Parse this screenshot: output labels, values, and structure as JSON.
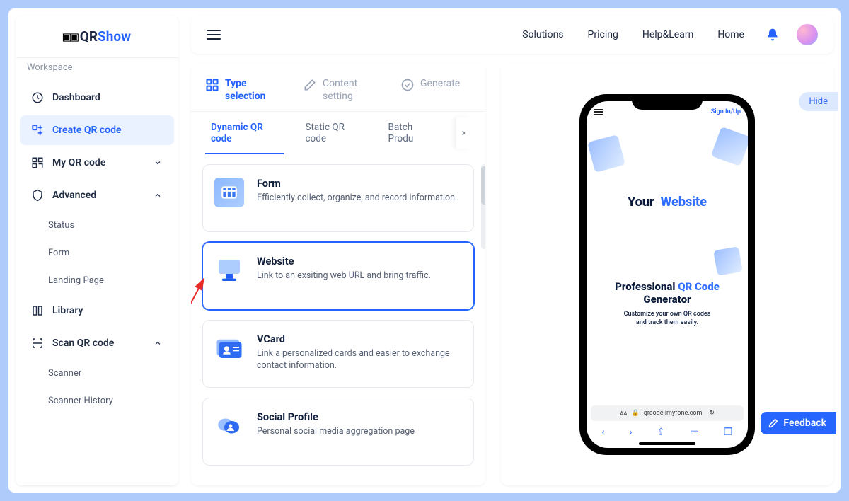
{
  "logo": {
    "prefix": "QR",
    "suffix": "Show"
  },
  "workspace_label": "Workspace",
  "sidebar": {
    "dashboard": "Dashboard",
    "create": "Create QR code",
    "myqr": "My QR code",
    "advanced": "Advanced",
    "advanced_children": {
      "status": "Status",
      "form": "Form",
      "landing": "Landing Page"
    },
    "library": "Library",
    "scan": "Scan QR code",
    "scan_children": {
      "scanner": "Scanner",
      "history": "Scanner History"
    }
  },
  "header": {
    "links": {
      "solutions": "Solutions",
      "pricing": "Pricing",
      "help": "Help&Learn",
      "home": "Home"
    }
  },
  "steps": {
    "type": "Type selection",
    "content": "Content setting",
    "generate": "Generate"
  },
  "tabs": {
    "dynamic": "Dynamic QR code",
    "static": "Static QR code",
    "batch": "Batch Produ"
  },
  "cards": {
    "form": {
      "title": "Form",
      "desc": "Efficiently collect, organize, and record information."
    },
    "website": {
      "title": "Website",
      "desc": "Link to an exsiting web URL and bring traffic."
    },
    "vcard": {
      "title": "VCard",
      "desc": "Link a personalized cards and easier to exchange contact information."
    },
    "social": {
      "title": "Social Profile",
      "desc": "Personal social media aggregation page"
    }
  },
  "preview": {
    "hide": "Hide",
    "signin": "Sign In/Up",
    "your": "Your",
    "website": "Website",
    "headline1": "Professional ",
    "headline2": "QR Code",
    "headline3": "Generator",
    "sub1": "Customize your own QR codes",
    "sub2": "and track them easily.",
    "url": "qrcode.imyfone.com"
  },
  "feedback": "Feedback"
}
